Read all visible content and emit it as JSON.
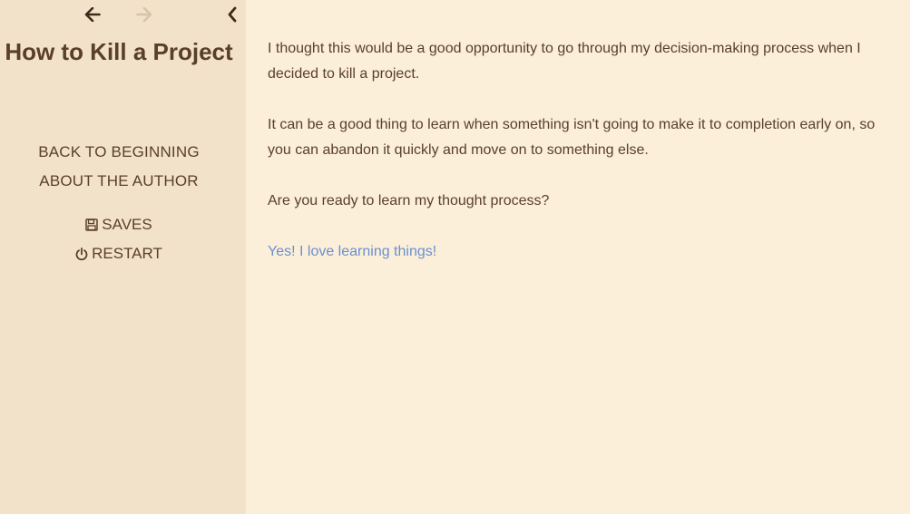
{
  "story": {
    "title": "How to Kill a Project"
  },
  "sidebar": {
    "nav_back_icon": "arrow-left-icon",
    "nav_forward_icon": "arrow-right-icon",
    "toggle_icon": "chevron-left-icon",
    "menu": [
      {
        "label": "BACK TO BEGINNING"
      },
      {
        "label": "ABOUT THE AUTHOR"
      }
    ],
    "utility": [
      {
        "label": "SAVES",
        "icon": "floppy-disk-icon"
      },
      {
        "label": "RESTART",
        "icon": "power-icon"
      }
    ]
  },
  "passage": {
    "paragraphs": [
      "I thought this would be a good opportunity to go through my decision-making process when I decided to kill a project.",
      "It can be a good thing to learn when something isn't going to make it to completion early on, so you can abandon it quickly and move on to something else.",
      "Are you ready to learn my thought process?"
    ],
    "link": "Yes! I love learning things!"
  },
  "colors": {
    "page_background": "#fbefd9",
    "sidebar_background": "#f3e2ca",
    "text": "#5a3f2a",
    "link": "#6b8fd0",
    "disabled_icon": "#d9c3a6"
  }
}
